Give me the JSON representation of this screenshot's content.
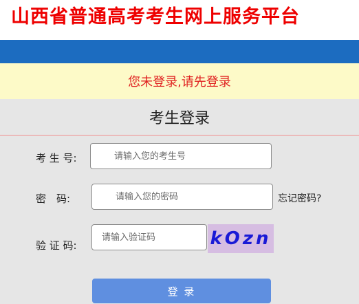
{
  "header": {
    "title": "山西省普通高考考生网上服务平台"
  },
  "notice": {
    "text": "您未登录,请先登录"
  },
  "login": {
    "title": "考生登录",
    "exam_id": {
      "label": "考 生 号:",
      "placeholder": "请输入您的考生号",
      "value": ""
    },
    "password": {
      "label": "密　码:",
      "placeholder": "请输入您的密码",
      "value": ""
    },
    "forgot_password": "忘记密码?",
    "captcha": {
      "label": "验 证 码:",
      "placeholder": "请输入验证码",
      "value": "",
      "code": "kOzn"
    },
    "submit": "登 录"
  },
  "colors": {
    "title_red": "#ee0000",
    "nav_blue": "#1c6cc0",
    "notice_bg": "#fdfac8",
    "notice_text": "#e02020",
    "panel_bg": "#e6e6e6",
    "captcha_bg": "#d6bde2",
    "captcha_text": "#1a1ad6",
    "button_blue": "#5f8fe0"
  }
}
